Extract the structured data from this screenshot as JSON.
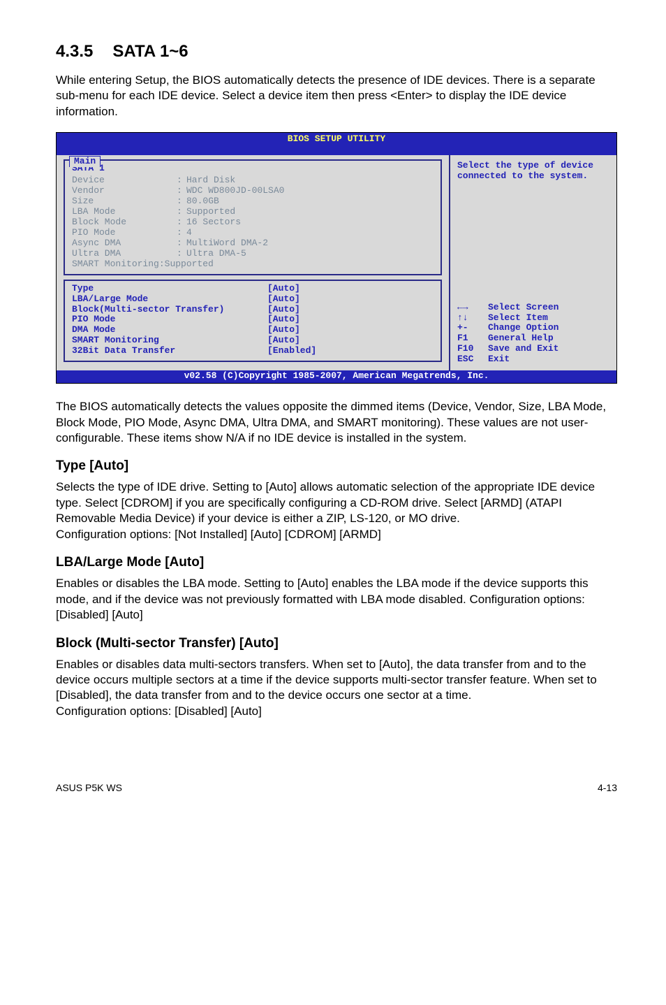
{
  "section": {
    "num": "4.3.5",
    "title": "SATA 1~6"
  },
  "intro": "While entering Setup, the BIOS automatically detects the presence of IDE devices. There is a separate sub-menu for each IDE device. Select a device item then press <Enter> to display the IDE device information.",
  "bios": {
    "title": "BIOS SETUP UTILITY",
    "tab": "Main",
    "panel_title": "SATA 1",
    "detected": [
      {
        "label": "Device",
        "value": "Hard Disk"
      },
      {
        "label": "Vendor",
        "value": "WDC WD800JD-00LSA0"
      },
      {
        "label": "Size",
        "value": "80.0GB"
      },
      {
        "label": "LBA Mode",
        "value": "Supported"
      },
      {
        "label": "Block Mode",
        "value": "16 Sectors"
      },
      {
        "label": "PIO Mode",
        "value": "4"
      },
      {
        "label": "Async DMA",
        "value": "MultiWord DMA-2"
      },
      {
        "label": "Ultra DMA",
        "value": "Ultra DMA-5"
      },
      {
        "label": "SMART Monitoring",
        "value": "Supported",
        "no_colon_col": true
      }
    ],
    "options": [
      {
        "label": "Type",
        "value": "[Auto]"
      },
      {
        "label": "LBA/Large Mode",
        "value": "[Auto]"
      },
      {
        "label": "Block(Multi-sector Transfer)",
        "value": "[Auto]"
      },
      {
        "label": "PIO Mode",
        "value": "[Auto]"
      },
      {
        "label": "DMA Mode",
        "value": "[Auto]"
      },
      {
        "label": "SMART Monitoring",
        "value": "[Auto]"
      },
      {
        "label": "32Bit Data Transfer",
        "value": "[Enabled]"
      }
    ],
    "help": "Select the type of device connected to the system.",
    "legend": [
      {
        "key": "←→",
        "label": "Select Screen"
      },
      {
        "key": "↑↓",
        "label": "Select Item"
      },
      {
        "key": "+-",
        "label": "Change Option"
      },
      {
        "key": "F1",
        "label": "General Help"
      },
      {
        "key": "F10",
        "label": "Save and Exit"
      },
      {
        "key": "ESC",
        "label": "Exit"
      }
    ],
    "footer": "v02.58 (C)Copyright 1985-2007, American Megatrends, Inc."
  },
  "after_bios": "The BIOS automatically detects the values opposite the dimmed items (Device, Vendor, Size, LBA Mode, Block Mode, PIO Mode, Async DMA, Ultra DMA, and SMART monitoring). These values are not user-configurable. These items show N/A if no IDE device is installed in the system.",
  "type": {
    "heading": "Type [Auto]",
    "p1": "Selects the type of IDE drive. Setting to [Auto] allows automatic selection of the appropriate IDE device type. Select [CDROM] if you are specifically configuring a CD-ROM drive. Select [ARMD] (ATAPI Removable Media Device) if your device is either a ZIP, LS-120, or MO drive.",
    "p2": "Configuration options: [Not Installed] [Auto] [CDROM] [ARMD]"
  },
  "lba": {
    "heading": "LBA/Large Mode [Auto]",
    "p": "Enables or disables the LBA mode. Setting to [Auto] enables the LBA mode if the device supports this mode, and if the device was not previously formatted with LBA mode disabled. Configuration options: [Disabled] [Auto]"
  },
  "block": {
    "heading": "Block (Multi-sector Transfer) [Auto]",
    "p1": "Enables or disables data multi-sectors transfers. When set to [Auto], the data transfer from and to the device occurs multiple sectors at a time if the device supports multi-sector transfer feature. When set to [Disabled], the data transfer from and to the device occurs one sector at a time.",
    "p2": "Configuration options: [Disabled] [Auto]"
  },
  "footer": {
    "left": "ASUS P5K WS",
    "right": "4-13"
  }
}
